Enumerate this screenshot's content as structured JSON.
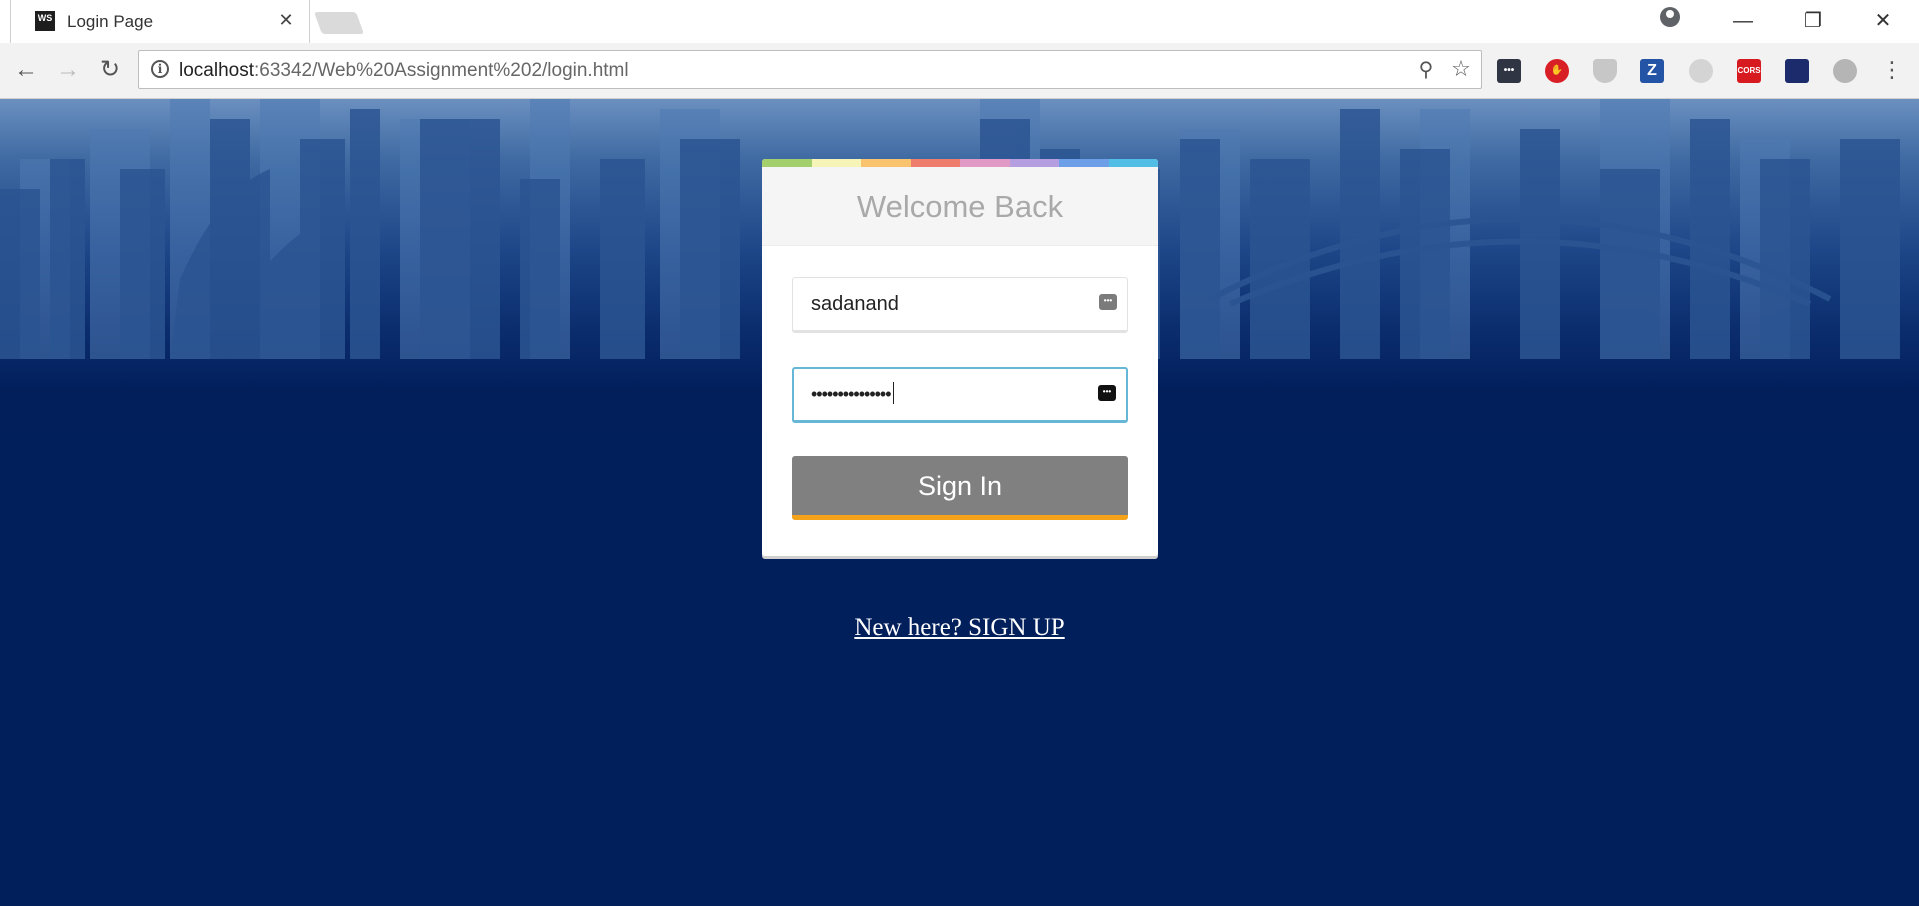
{
  "browser": {
    "tab": {
      "favicon_label": "WS",
      "title": "Login Page",
      "close_glyph": "✕"
    },
    "window_controls": {
      "minimize": "—",
      "maximize": "❐",
      "close": "✕"
    },
    "toolbar": {
      "back_glyph": "←",
      "forward_glyph": "→",
      "reload_glyph": "↻",
      "url_host": "localhost",
      "url_rest": ":63342/Web%20Assignment%202/login.html",
      "zoom_glyph": "⚲",
      "star_glyph": "☆",
      "menu_glyph": "⋮"
    },
    "extensions": [
      {
        "name": "ext-lastpass-icon",
        "label": "•••"
      },
      {
        "name": "ext-adblock-icon",
        "label": ""
      },
      {
        "name": "ext-shield-icon",
        "label": ""
      },
      {
        "name": "ext-zotero-icon",
        "label": "Z"
      },
      {
        "name": "ext-swirl-icon",
        "label": ""
      },
      {
        "name": "ext-cors-icon",
        "label": "CORS"
      },
      {
        "name": "ext-palette-icon",
        "label": ""
      },
      {
        "name": "ext-accessibility-icon",
        "label": ""
      }
    ]
  },
  "login": {
    "title": "Welcome Back",
    "username_value": "sadanand",
    "password_value": "•••••••••••••••",
    "sign_in_label": "Sign In",
    "signup_link": "New here? SIGN UP",
    "keyboard_icon_label": "•••"
  },
  "colors": {
    "page_background": "#011f5b",
    "button_background": "#808080",
    "button_accent": "#f5a21b",
    "focus_border": "#65b7d5",
    "title_color": "#a9a9a9",
    "stripe": [
      "#a3d06c",
      "#f7f4b8",
      "#f9c36d",
      "#ef7d6e",
      "#e199c6",
      "#b59ee0",
      "#6d9ee8",
      "#52bde5"
    ]
  }
}
